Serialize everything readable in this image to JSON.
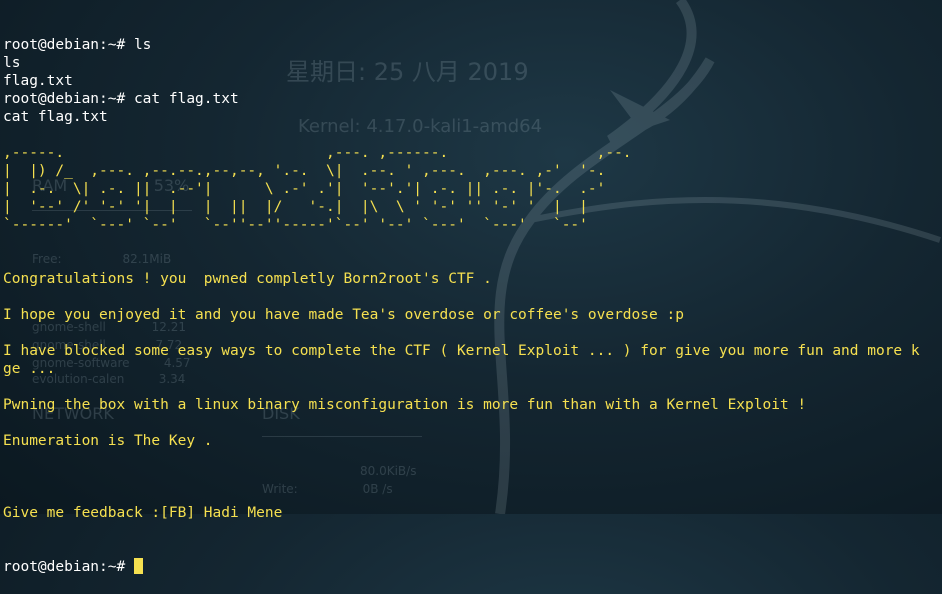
{
  "background": {
    "date": "星期日: 25 八月 2019",
    "kernel": "Kernel: 4.17.0-kali1-amd64",
    "ram_label": "RAM",
    "ram_percent": "53%",
    "free_label": "Free:",
    "free_value": "82.1MiB",
    "processes": [
      {
        "name": "gnome-shell",
        "value": "12.21"
      },
      {
        "name": "gnome-shell",
        "value": "7.72"
      },
      {
        "name": "gnome-software",
        "value": "4.57"
      },
      {
        "name": "evolution-calen",
        "value": "3.34"
      }
    ],
    "network_label": "NETWORK",
    "disk_label": "DISK",
    "disk_read": "80.0KiB/s",
    "disk_write_label": "Write:",
    "disk_write": "0B /s"
  },
  "terminal": {
    "lines": [
      {
        "text": "root@debian:~# ls",
        "color": "white"
      },
      {
        "text": "ls",
        "color": "white"
      },
      {
        "text": "flag.txt",
        "color": "white"
      },
      {
        "text": "root@debian:~# cat flag.txt",
        "color": "white"
      },
      {
        "text": "cat flag.txt",
        "color": "white"
      },
      {
        "text": "",
        "color": "white"
      },
      {
        "text": ",-----.                              ,---. ,------.                 ,--.",
        "color": "yellow"
      },
      {
        "text": "|  |) /_  ,---. ,--.--.,--,--, '.-.  \\|  .--. ' ,---.  ,---. ,-'  '-.",
        "color": "yellow"
      },
      {
        "text": "|  .-.  \\| .-. ||  .--'|      \\ .-' .'|  '--'.'| .-. || .-. |'-.  .-'",
        "color": "yellow"
      },
      {
        "text": "|  '--' /' '-' '|  |   |  ||  |/   '-.|  |\\  \\ ' '-' '' '-' '  |  |",
        "color": "yellow"
      },
      {
        "text": "`------'  `---' `--'   `--''--''-----'`--' '--' `---'  `---'   `--'",
        "color": "yellow"
      },
      {
        "text": "",
        "color": "yellow"
      },
      {
        "text": "",
        "color": "yellow"
      },
      {
        "text": "Congratulations ! you  pwned completly Born2root's CTF .",
        "color": "yellow"
      },
      {
        "text": "",
        "color": "yellow"
      },
      {
        "text": "I hope you enjoyed it and you have made Tea's overdose or coffee's overdose :p",
        "color": "yellow"
      },
      {
        "text": "",
        "color": "yellow"
      },
      {
        "text": "I have blocked some easy ways to complete the CTF ( Kernel Exploit ... ) for give you more fun and more k",
        "color": "yellow"
      },
      {
        "text": "ge ...",
        "color": "yellow"
      },
      {
        "text": "",
        "color": "yellow"
      },
      {
        "text": "Pwning the box with a linux binary misconfiguration is more fun than with a Kernel Exploit !",
        "color": "yellow"
      },
      {
        "text": "",
        "color": "yellow"
      },
      {
        "text": "Enumeration is The Key .",
        "color": "yellow"
      },
      {
        "text": "",
        "color": "yellow"
      },
      {
        "text": "",
        "color": "yellow"
      },
      {
        "text": "",
        "color": "yellow"
      },
      {
        "text": "Give me feedback :[FB] Hadi Mene",
        "color": "yellow"
      }
    ],
    "prompt": "root@debian:~# "
  },
  "colors": {
    "white": "#ffffff",
    "yellow": "#f5e050"
  }
}
